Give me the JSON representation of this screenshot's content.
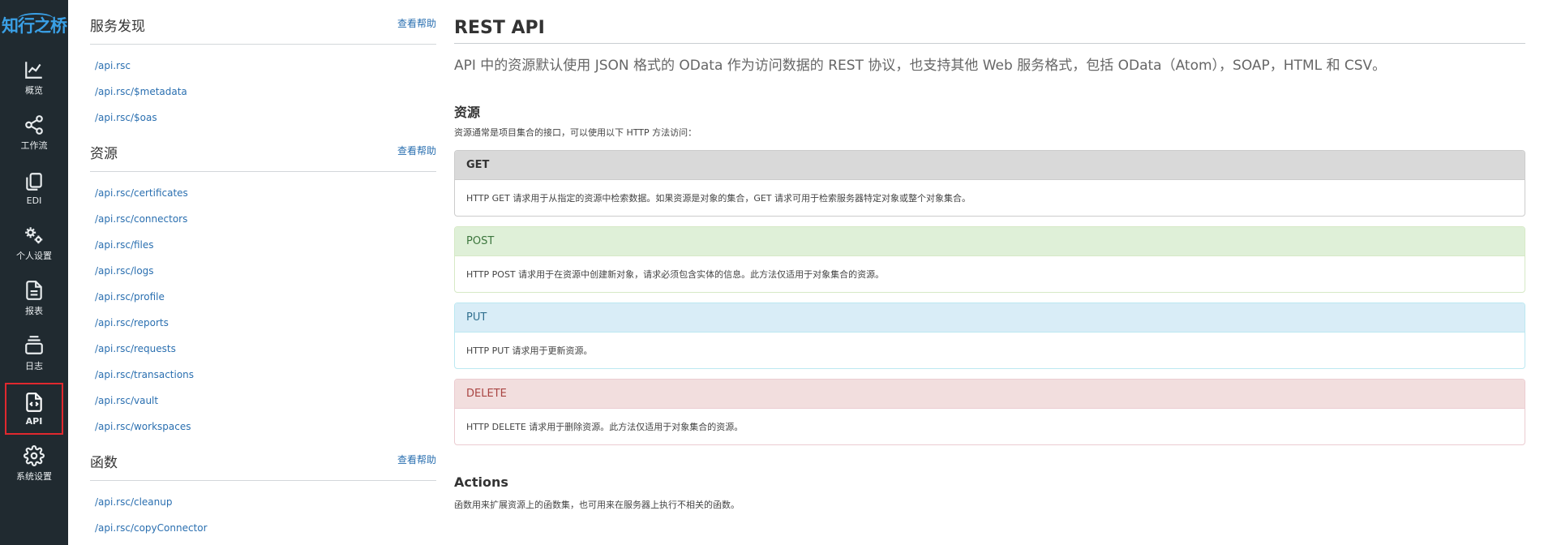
{
  "sidebar": {
    "logo": "知行之桥",
    "items": [
      {
        "label": "概览",
        "icon": "chart-line-icon"
      },
      {
        "label": "工作流",
        "icon": "share-nodes-icon"
      },
      {
        "label": "EDI",
        "icon": "copy-files-icon"
      },
      {
        "label": "个人设置",
        "icon": "gears-icon"
      },
      {
        "label": "报表",
        "icon": "document-icon"
      },
      {
        "label": "日志",
        "icon": "layers-icon"
      },
      {
        "label": "API",
        "icon": "api-file-icon",
        "active": true
      },
      {
        "label": "系统设置",
        "icon": "gear-icon"
      }
    ]
  },
  "links": {
    "discovery": {
      "title": "服务发现",
      "help": "查看帮助",
      "items": [
        "/api.rsc",
        "/api.rsc/$metadata",
        "/api.rsc/$oas"
      ]
    },
    "resources": {
      "title": "资源",
      "help": "查看帮助",
      "items": [
        "/api.rsc/certificates",
        "/api.rsc/connectors",
        "/api.rsc/files",
        "/api.rsc/logs",
        "/api.rsc/profile",
        "/api.rsc/reports",
        "/api.rsc/requests",
        "/api.rsc/transactions",
        "/api.rsc/vault",
        "/api.rsc/workspaces"
      ]
    },
    "functions": {
      "title": "函数",
      "help": "查看帮助",
      "items": [
        "/api.rsc/cleanup",
        "/api.rsc/copyConnector"
      ]
    }
  },
  "main": {
    "title": "REST API",
    "intro": "API 中的资源默认使用 JSON 格式的 OData 作为访问数据的 REST 协议，也支持其他 Web 服务格式，包括 OData（Atom），SOAP，HTML 和 CSV。",
    "resources_heading": "资源",
    "resources_text": "资源通常是项目集合的接口，可以使用以下 HTTP 方法访问：",
    "methods": [
      {
        "name": "GET",
        "desc": "HTTP GET 请求用于从指定的资源中检索数据。如果资源是对象的集合，GET 请求可用于检索服务器特定对象或整个对象集合。"
      },
      {
        "name": "POST",
        "desc": "HTTP POST 请求用于在资源中创建新对象，请求必须包含实体的信息。此方法仅适用于对象集合的资源。"
      },
      {
        "name": "PUT",
        "desc": "HTTP PUT 请求用于更新资源。"
      },
      {
        "name": "DELETE",
        "desc": "HTTP DELETE 请求用于删除资源。此方法仅适用于对象集合的资源。"
      }
    ],
    "actions_heading": "Actions",
    "actions_text": "函数用来扩展资源上的函数集，也可用来在服务器上执行不相关的函数。"
  }
}
